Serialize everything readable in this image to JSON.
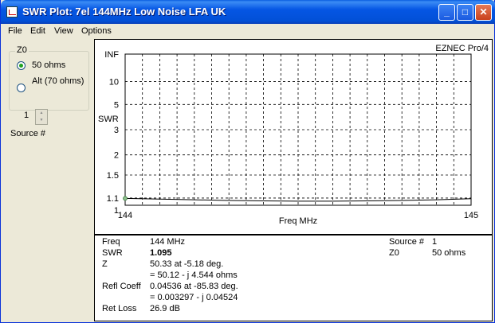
{
  "window": {
    "title": "SWR Plot: 7el 144MHz Low Noise LFA UK",
    "controls": {
      "minimize": "_",
      "maximize": "□",
      "close": "✕"
    }
  },
  "menu": [
    "File",
    "Edit",
    "View",
    "Options"
  ],
  "z0": {
    "group_label": "Z0",
    "option_50": "50 ohms",
    "option_alt": "Alt (70 ohms)",
    "selected": "50 ohms"
  },
  "source": {
    "value": "1",
    "label": "Source #"
  },
  "chart_data": {
    "type": "line",
    "watermark": "EZNEC Pro/4",
    "ylabel": "SWR",
    "xlabel": "Freq MHz",
    "x_ticks": [
      "144",
      "145"
    ],
    "xlim": [
      144,
      145
    ],
    "y_ticks": [
      {
        "label": "INF",
        "value": "INF"
      },
      {
        "label": "10",
        "value": 10
      },
      {
        "label": "5",
        "value": 5
      },
      {
        "label": "3",
        "value": 3
      },
      {
        "label": "2",
        "value": 2
      },
      {
        "label": "1.5",
        "value": 1.5
      },
      {
        "label": "1.1",
        "value": 1.1
      },
      {
        "label": "1",
        "value": 1
      }
    ],
    "grid": true,
    "series": [
      {
        "x": [
          144.0,
          144.1,
          144.2,
          144.3,
          144.4,
          144.5,
          144.6,
          144.7,
          144.8,
          144.9,
          145.0
        ],
        "y": [
          1.095,
          1.085,
          1.075,
          1.065,
          1.06,
          1.055,
          1.055,
          1.06,
          1.065,
          1.075,
          1.09
        ]
      }
    ],
    "marker": {
      "x": 144,
      "y": 1.095
    }
  },
  "info": {
    "freq_label": "Freq",
    "freq_value": "144 MHz",
    "swr_label": "SWR",
    "swr_value": "1.095",
    "z_label": "Z",
    "z_value1": "50.33 at -5.18 deg.",
    "z_value2": "= 50.12 - j 4.544 ohms",
    "refl_label": "Refl Coeff",
    "refl_value1": "0.04536 at -85.83 deg.",
    "refl_value2": "= 0.003297 - j 0.04524",
    "retloss_label": "Ret Loss",
    "retloss_value": "26.9 dB",
    "source_label": "Source #",
    "source_value": "1",
    "z0_label": "Z0",
    "z0_value": "50 ohms"
  }
}
